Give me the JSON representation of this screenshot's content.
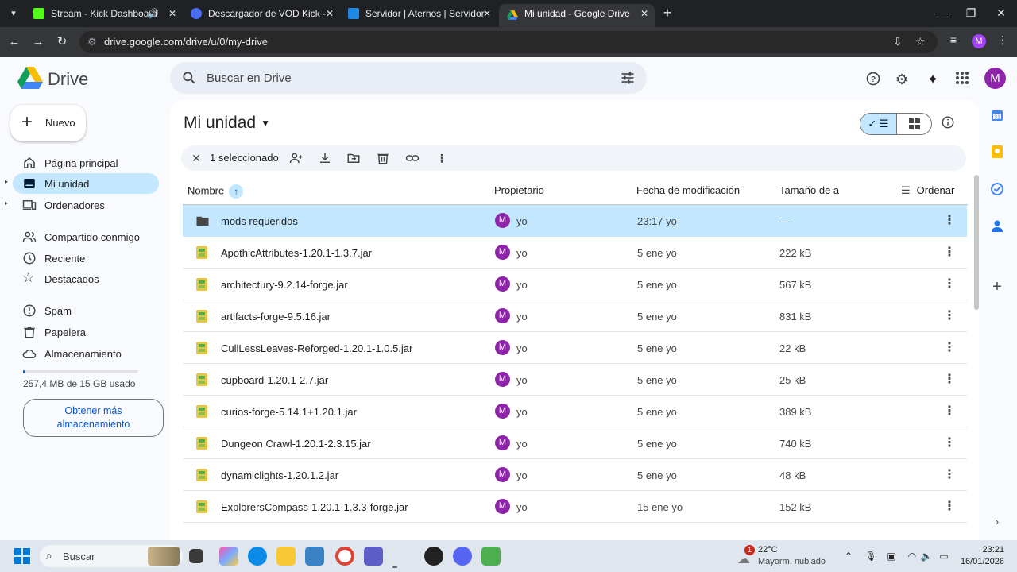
{
  "browser": {
    "tabs": [
      {
        "title": "Stream - Kick Dashboard",
        "favicon_color": "#53fc18"
      },
      {
        "title": "Descargador de VOD Kick - Listo",
        "favicon_color": "#4a6cf7"
      },
      {
        "title": "Servidor | Aternos | Servidor de",
        "favicon_color": "#1e88e5"
      },
      {
        "title": "Mi unidad - Google Drive",
        "favicon_color": "#fbbc04"
      }
    ],
    "url": "drive.google.com/drive/u/0/my-drive",
    "profile_initial": "M"
  },
  "app": {
    "name": "Drive",
    "search_placeholder": "Buscar en Drive",
    "avatar_initial": "M"
  },
  "sidebar": {
    "new_button": "Nuevo",
    "items": [
      {
        "label": "Página principal",
        "icon": "home-icon"
      },
      {
        "label": "Mi unidad",
        "icon": "drive-icon",
        "active": true
      },
      {
        "label": "Ordenadores",
        "icon": "computer-icon"
      },
      {
        "label": "Compartido conmigo",
        "icon": "people-icon"
      },
      {
        "label": "Reciente",
        "icon": "clock-icon"
      },
      {
        "label": "Destacados",
        "icon": "star-icon"
      },
      {
        "label": "Spam",
        "icon": "spam-icon"
      },
      {
        "label": "Papelera",
        "icon": "trash-icon"
      },
      {
        "label": "Almacenamiento",
        "icon": "cloud-icon"
      }
    ],
    "storage_used_fraction": 0.017,
    "storage_text": "257,4 MB de 15 GB usado",
    "get_more_line1": "Obtener más",
    "get_more_line2": "almacenamiento"
  },
  "main": {
    "title": "Mi unidad",
    "selection_count": "1 seleccionado",
    "columns": {
      "name": "Nombre",
      "owner": "Propietario",
      "modified": "Fecha de modificación",
      "size": "Tamaño de a",
      "sort": "Ordenar"
    },
    "rows": [
      {
        "name": "mods requeridos",
        "type": "folder",
        "owner": "yo",
        "owner_initial": "M",
        "modified": "23:17 yo",
        "size": "—",
        "selected": true
      },
      {
        "name": "ApothicAttributes-1.20.1-1.3.7.jar",
        "type": "file",
        "owner": "yo",
        "owner_initial": "M",
        "modified": "5 ene yo",
        "size": "222 kB"
      },
      {
        "name": "architectury-9.2.14-forge.jar",
        "type": "file",
        "owner": "yo",
        "owner_initial": "M",
        "modified": "5 ene yo",
        "size": "567 kB"
      },
      {
        "name": "artifacts-forge-9.5.16.jar",
        "type": "file",
        "owner": "yo",
        "owner_initial": "M",
        "modified": "5 ene yo",
        "size": "831 kB"
      },
      {
        "name": "CullLessLeaves-Reforged-1.20.1-1.0.5.jar",
        "type": "file",
        "owner": "yo",
        "owner_initial": "M",
        "modified": "5 ene yo",
        "size": "22 kB"
      },
      {
        "name": "cupboard-1.20.1-2.7.jar",
        "type": "file",
        "owner": "yo",
        "owner_initial": "M",
        "modified": "5 ene yo",
        "size": "25 kB"
      },
      {
        "name": "curios-forge-5.14.1+1.20.1.jar",
        "type": "file",
        "owner": "yo",
        "owner_initial": "M",
        "modified": "5 ene yo",
        "size": "389 kB"
      },
      {
        "name": "Dungeon Crawl-1.20.1-2.3.15.jar",
        "type": "file",
        "owner": "yo",
        "owner_initial": "M",
        "modified": "5 ene yo",
        "size": "740 kB"
      },
      {
        "name": "dynamiclights-1.20.1.2.jar",
        "type": "file",
        "owner": "yo",
        "owner_initial": "M",
        "modified": "5 ene yo",
        "size": "48 kB"
      },
      {
        "name": "ExplorersCompass-1.20.1-1.3.3-forge.jar",
        "type": "file",
        "owner": "yo",
        "owner_initial": "M",
        "modified": "15 ene yo",
        "size": "152 kB"
      }
    ]
  },
  "taskbar": {
    "search_placeholder": "Buscar",
    "weather_temp": "22°C",
    "weather_cond": "Mayorm. nublado",
    "weather_badge": "1",
    "time": "23:21",
    "date": "16/01/2026"
  }
}
